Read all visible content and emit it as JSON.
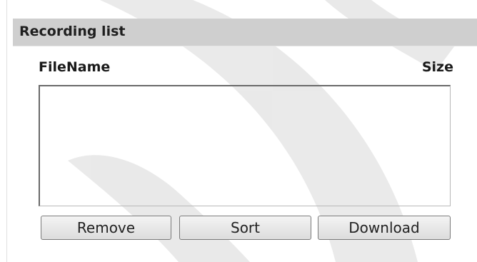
{
  "panel": {
    "title": "Recording list"
  },
  "list": {
    "columns": {
      "filename": "FileName",
      "size": "Size"
    },
    "items": []
  },
  "buttons": {
    "remove": "Remove",
    "sort": "Sort",
    "download": "Download"
  },
  "colors": {
    "header_background": "#cfcfcf",
    "watermark": "#e6e6e6"
  },
  "icons": {
    "watermark": "sail-logo-watermark"
  }
}
